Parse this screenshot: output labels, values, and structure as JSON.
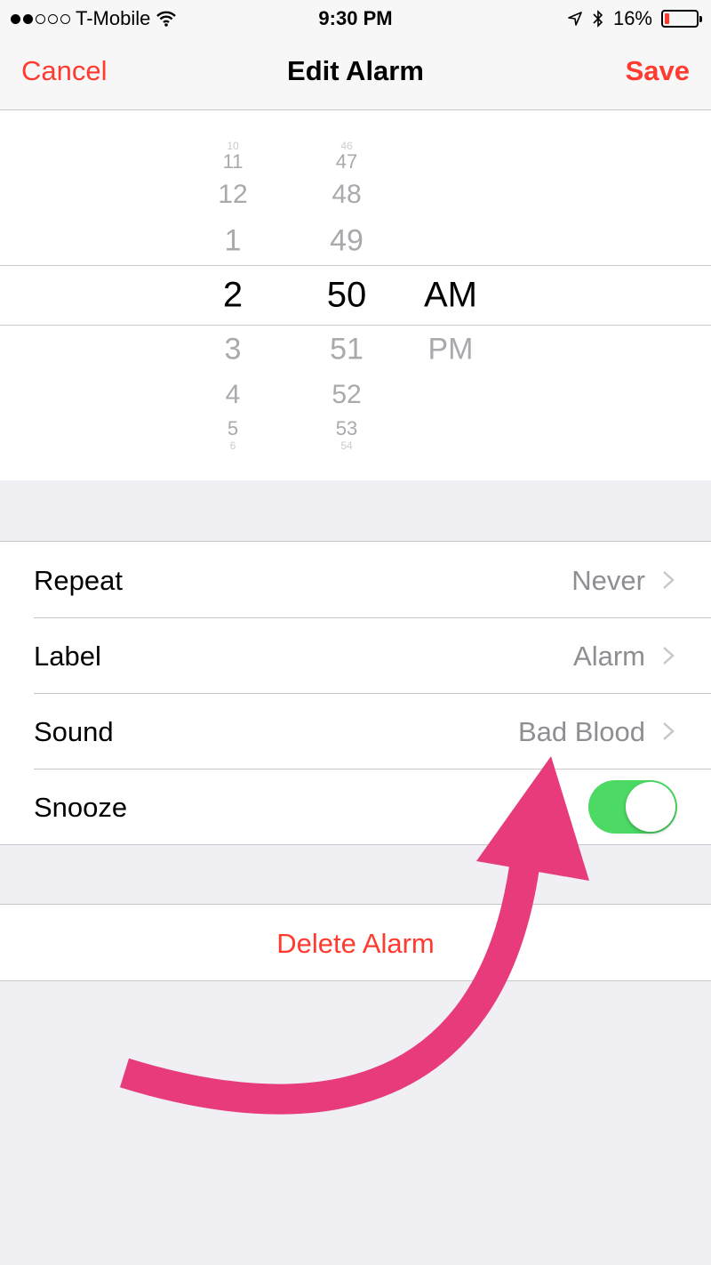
{
  "status_bar": {
    "carrier": "T-Mobile",
    "time": "9:30 PM",
    "battery": "16%",
    "battery_level": 0.16,
    "signal_bars_filled": 2,
    "signal_bars_total": 5
  },
  "nav": {
    "cancel": "Cancel",
    "title": "Edit Alarm",
    "save": "Save",
    "accent_color": "#ff3b30"
  },
  "picker": {
    "hours": [
      "10",
      "11",
      "12",
      "1",
      "2",
      "3",
      "4",
      "5",
      "6"
    ],
    "minutes": [
      "46",
      "47",
      "48",
      "49",
      "50",
      "51",
      "52",
      "53",
      "54"
    ],
    "ampm": [
      "AM",
      "PM"
    ],
    "selected_hour": "2",
    "selected_minute": "50",
    "selected_ampm": "AM"
  },
  "settings": {
    "repeat": {
      "label": "Repeat",
      "value": "Never"
    },
    "alarm_label": {
      "label": "Label",
      "value": "Alarm"
    },
    "sound": {
      "label": "Sound",
      "value": "Bad Blood"
    },
    "snooze": {
      "label": "Snooze",
      "enabled": true,
      "on_color": "#4cd964"
    }
  },
  "delete": {
    "label": "Delete Alarm"
  },
  "annotation": {
    "arrow_color": "#e73b7c"
  },
  "icons": [
    "wifi-icon",
    "location-icon",
    "bluetooth-icon",
    "battery-icon",
    "chevron-right-icon"
  ]
}
